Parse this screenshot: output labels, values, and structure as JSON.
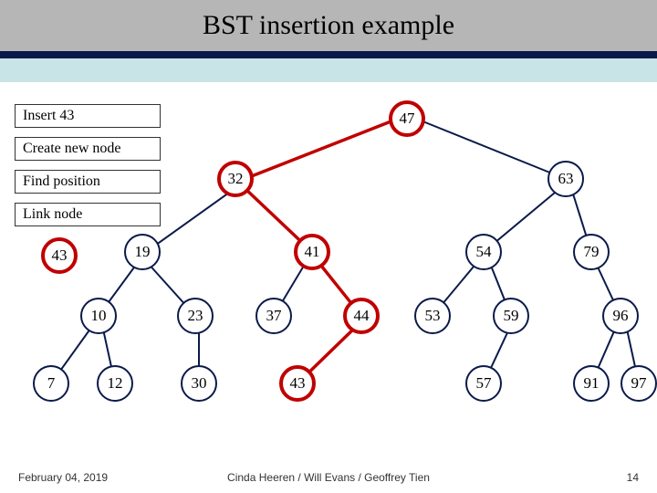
{
  "title": "BST insertion example",
  "steps": {
    "s1": "Insert 43",
    "s2": "Create new node",
    "s3": "Find position",
    "s4": "Link node"
  },
  "new_node_label": "43",
  "nodes": {
    "n47": "47",
    "n32": "32",
    "n63": "63",
    "n19": "19",
    "n41": "41",
    "n54": "54",
    "n79": "79",
    "n10": "10",
    "n23": "23",
    "n37": "37",
    "n44": "44",
    "n53": "53",
    "n59": "59",
    "n96": "96",
    "n7": "7",
    "n12": "12",
    "n30": "30",
    "n43": "43",
    "n57": "57",
    "n91": "91",
    "n97": "97"
  },
  "footer": {
    "date": "February 04, 2019",
    "authors": "Cinda Heeren / Will Evans / Geoffrey Tien",
    "page": "14"
  }
}
